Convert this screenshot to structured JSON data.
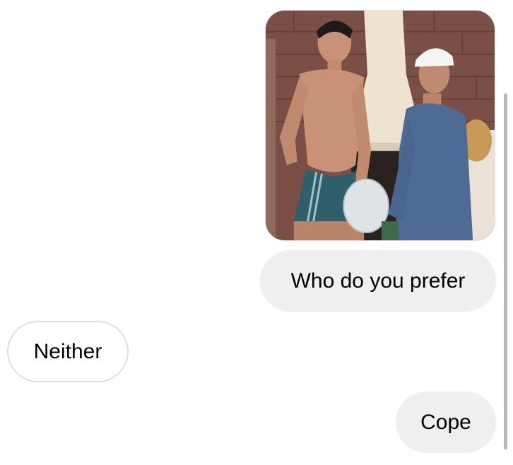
{
  "conversation": {
    "messages": [
      {
        "direction": "sent",
        "type": "image",
        "alt_icon": "photo-icon"
      },
      {
        "direction": "sent",
        "type": "text",
        "text": "Who do you prefer"
      },
      {
        "direction": "received",
        "type": "text",
        "text": "Neither"
      },
      {
        "direction": "sent",
        "type": "text",
        "text": "Cope"
      }
    ]
  },
  "colors": {
    "sent_bubble": "#efefef",
    "received_bubble_border": "#dedede",
    "text": "#000000",
    "scrollbar": "#b8b8b8"
  }
}
